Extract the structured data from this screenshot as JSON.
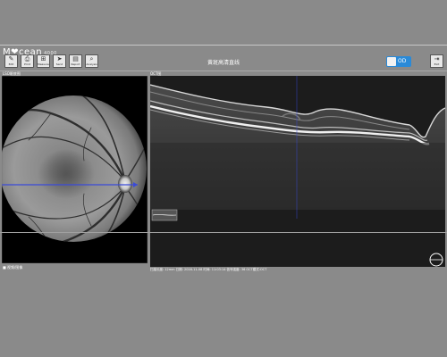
{
  "header": {
    "logo": "M❤cean",
    "logo_sub": "4000",
    "title": "黄斑高清直线",
    "toolbar": [
      {
        "label": "Edit",
        "icon": "edit-icon"
      },
      {
        "label": "Print",
        "icon": "print-icon"
      },
      {
        "label": "Measure",
        "icon": "measure-icon"
      },
      {
        "label": "Send",
        "icon": "send-icon"
      },
      {
        "label": "Report",
        "icon": "report-icon"
      },
      {
        "label": "Analysis",
        "icon": "analysis-icon"
      }
    ],
    "toggle_label": "OD",
    "exit_label": "Exit"
  },
  "slo_panel": {
    "label": "LSO眼底图",
    "footer": "■ 视频/图像"
  },
  "oct_panel": {
    "label": "OCT图",
    "status": "扫描长度: 12mm    日期: 2016-11-08    时间: 11:03:14    信号强度: 36    OCT模式:OCT"
  },
  "colors": {
    "background": "#8a8a8a",
    "accent": "#2a8ad8",
    "scanline": "#3a4ad8"
  }
}
